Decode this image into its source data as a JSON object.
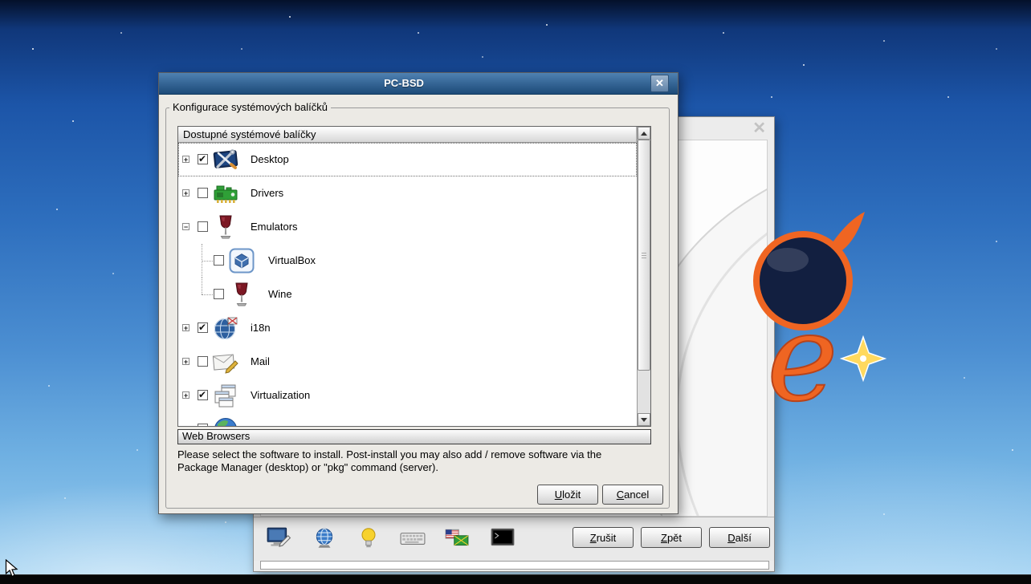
{
  "icons": {
    "dialog_close": "close-icon",
    "wizard_close": "close-icon"
  },
  "dialog": {
    "title": "PC-BSD",
    "groupbox_label": "Konfigurace systémových balíčků",
    "tree": {
      "header": "Dostupné systémové balíčky",
      "items": [
        {
          "label": "Desktop",
          "expand": "+",
          "checked": true,
          "icon": "desktop-icon",
          "level": 0,
          "focused": true
        },
        {
          "label": "Drivers",
          "expand": "+",
          "checked": false,
          "icon": "drivers-icon",
          "level": 0
        },
        {
          "label": "Emulators",
          "expand": "-",
          "checked": false,
          "icon": "emulators-icon",
          "level": 0
        },
        {
          "label": "VirtualBox",
          "expand": "",
          "checked": false,
          "icon": "virtualbox-icon",
          "level": 1
        },
        {
          "label": "Wine",
          "expand": "",
          "checked": false,
          "icon": "wine-icon",
          "level": 1,
          "last": true
        },
        {
          "label": "i18n",
          "expand": "+",
          "checked": true,
          "icon": "i18n-icon",
          "level": 0
        },
        {
          "label": "Mail",
          "expand": "+",
          "checked": false,
          "icon": "mail-icon",
          "level": 0
        },
        {
          "label": "Virtualization",
          "expand": "+",
          "checked": true,
          "icon": "virtualization-icon",
          "level": 0
        },
        {
          "label": "",
          "expand": "",
          "checked": false,
          "icon": "browser-icon",
          "level": 0,
          "partial": true
        }
      ]
    },
    "toolbox_section": "Web Browsers",
    "description_line1": "Please select the software to install. Post-install you may also add / remove software via the",
    "description_line2": "Package Manager (desktop) or \"pkg\" command (server).",
    "buttons": {
      "save": "Uložit",
      "cancel": "Cancel"
    }
  },
  "wizard": {
    "toolbar_icons": [
      "display-settings-icon",
      "network-globe-icon",
      "lightbulb-icon",
      "keyboard-icon",
      "locale-flags-icon",
      "terminal-icon"
    ],
    "buttons": {
      "cancel": "Zrušit",
      "back": "Zpět",
      "next": "Další"
    }
  }
}
